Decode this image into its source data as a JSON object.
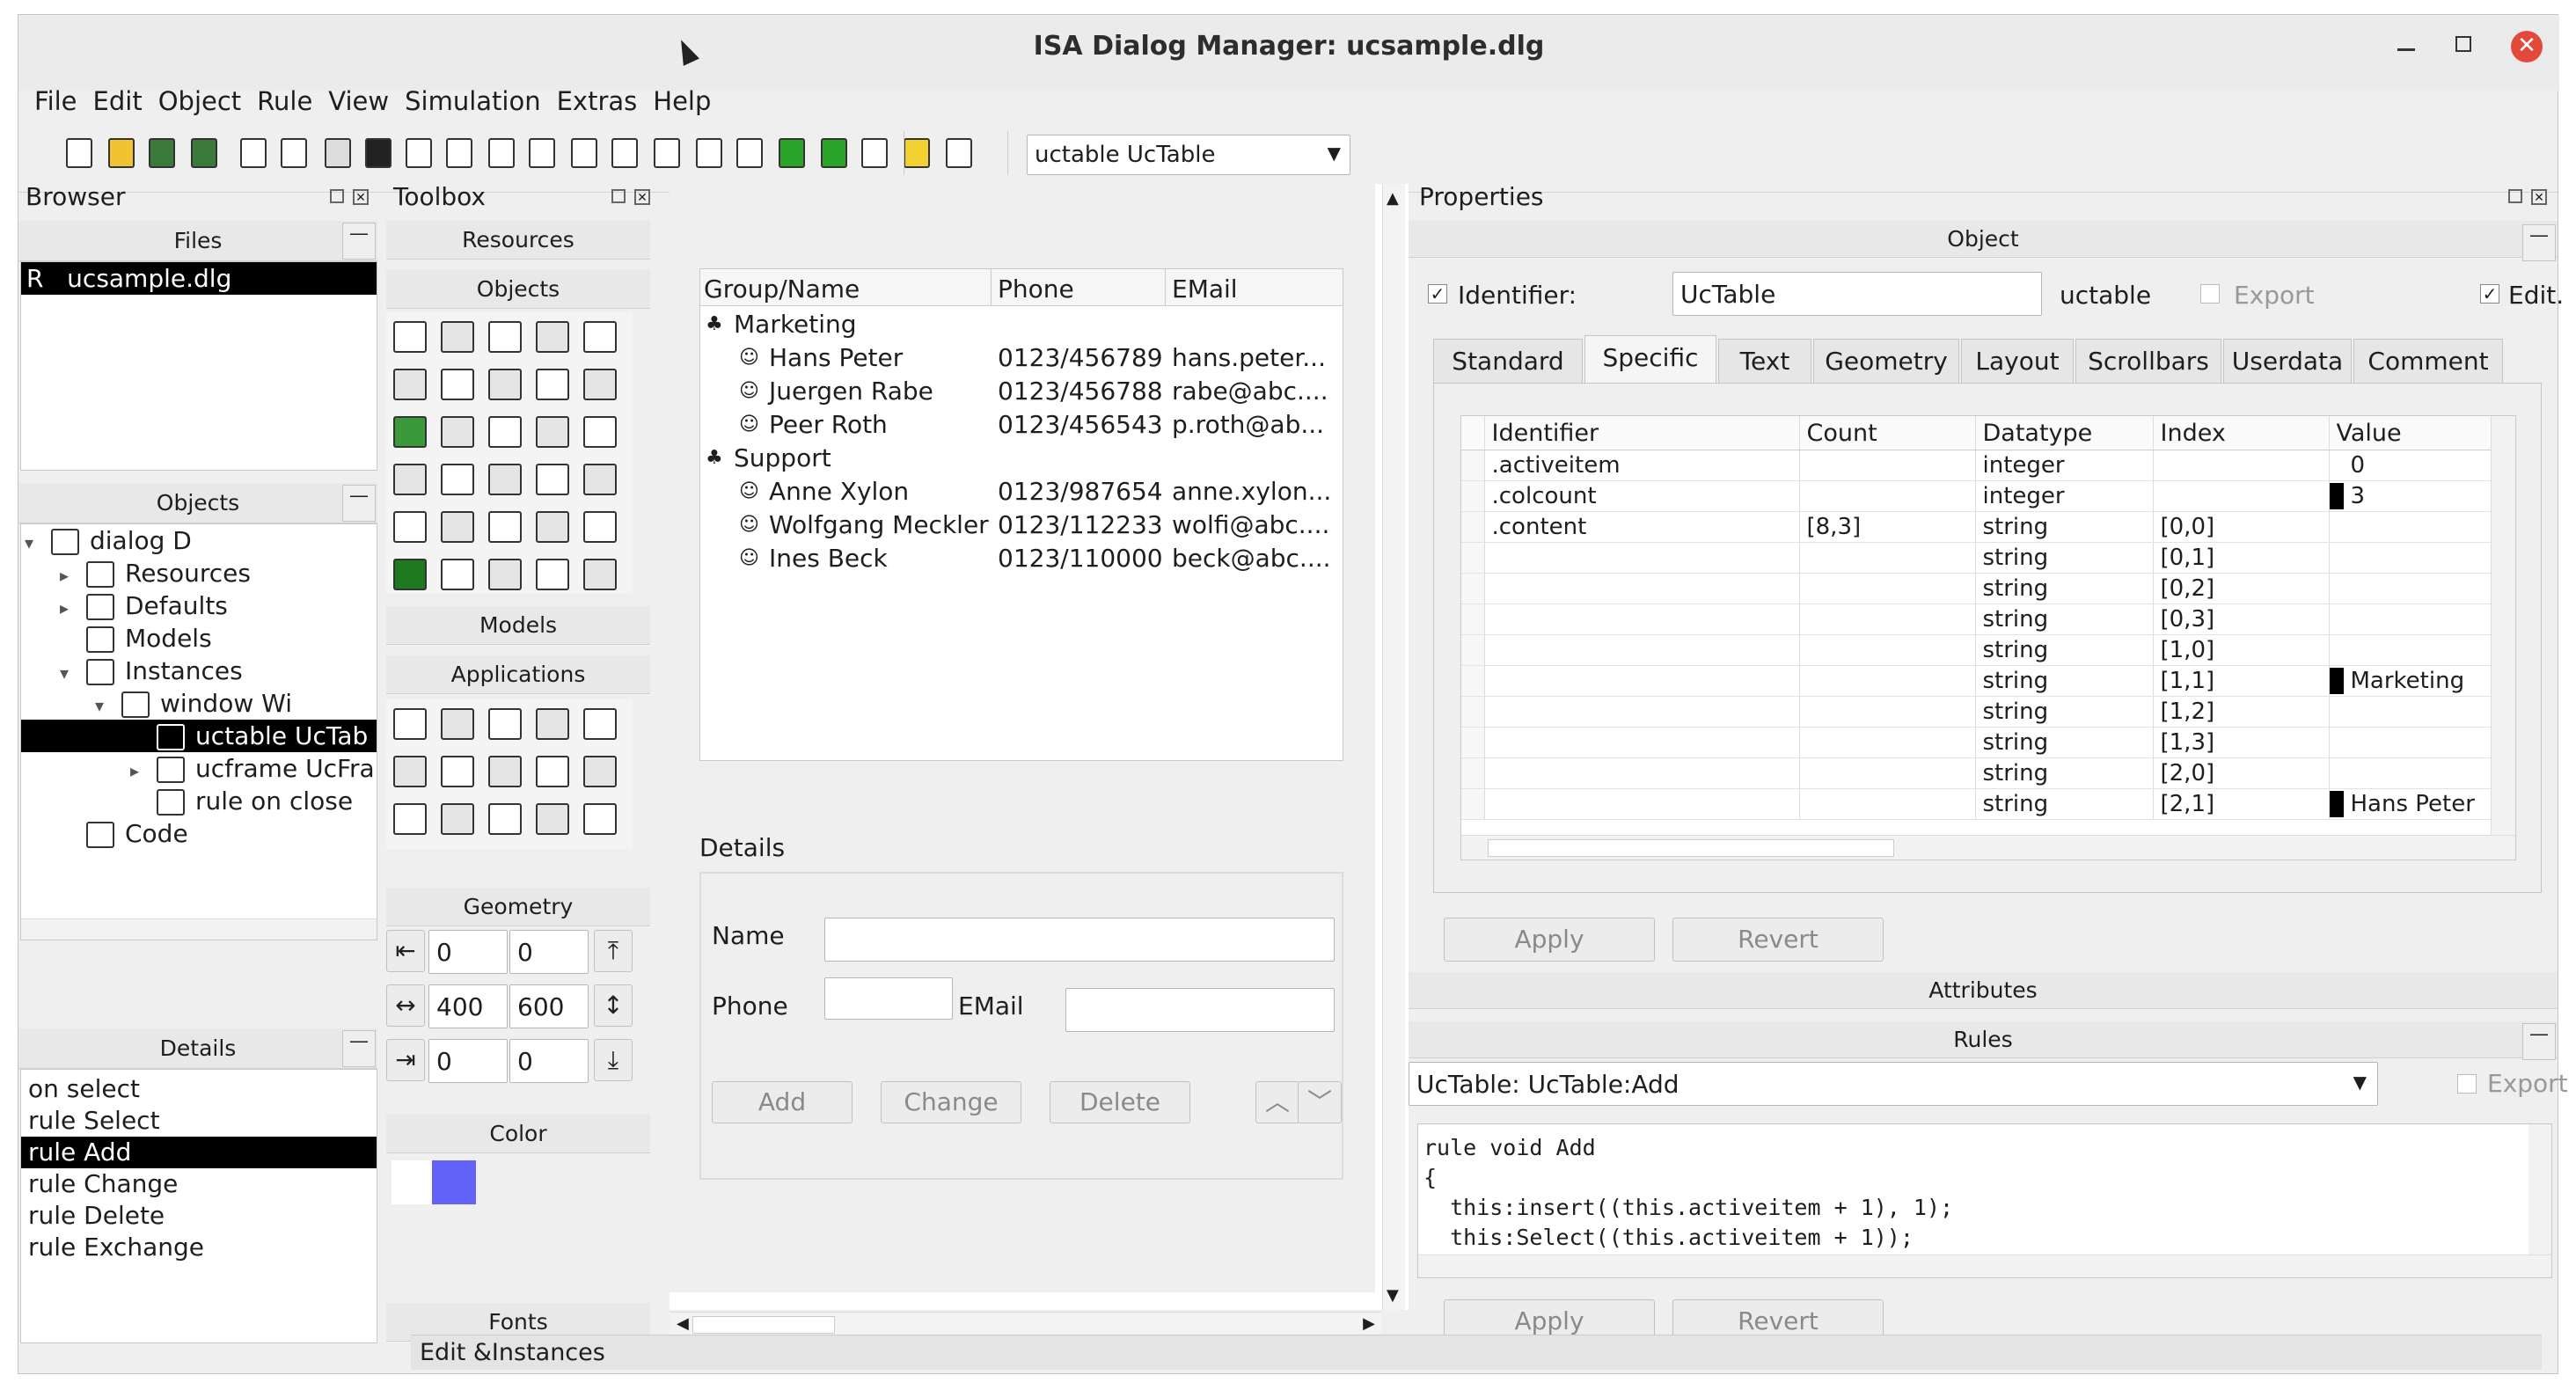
{
  "window": {
    "title": "ISA Dialog Manager: ucsample.dlg"
  },
  "menu": [
    "File",
    "Edit",
    "Object",
    "Rule",
    "View",
    "Simulation",
    "Extras",
    "Help"
  ],
  "toolbar": {
    "combo_value": "uctable UcTable"
  },
  "browser": {
    "title": "Browser",
    "files_header": "Files",
    "file_flag": "R",
    "file_name": "ucsample.dlg",
    "objects_header": "Objects",
    "tree": [
      {
        "label": "dialog D",
        "indent": 0
      },
      {
        "label": "Resources",
        "indent": 1
      },
      {
        "label": "Defaults",
        "indent": 1
      },
      {
        "label": "Models",
        "indent": 1
      },
      {
        "label": "Instances",
        "indent": 1
      },
      {
        "label": "window Wi",
        "indent": 2
      },
      {
        "label": "uctable UcTab",
        "indent": 3
      },
      {
        "label": "ucframe UcFra",
        "indent": 3
      },
      {
        "label": "rule on close",
        "indent": 3
      },
      {
        "label": "Code",
        "indent": 1
      }
    ],
    "details_header": "Details",
    "details": [
      "on select",
      "rule Select",
      "rule Add",
      "rule Change",
      "rule Delete",
      "rule Exchange"
    ]
  },
  "toolbox": {
    "title": "Toolbox",
    "resources": "Resources",
    "objects": "Objects",
    "models": "Models",
    "applications": "Applications",
    "geometry": "Geometry",
    "geo_values": [
      "0",
      "0",
      "400",
      "600",
      "0",
      "0"
    ],
    "color": "Color",
    "fonts": "Fonts"
  },
  "preview": {
    "columns": [
      "Group/Name",
      "Phone",
      "EMail"
    ],
    "rows": [
      {
        "group": "Marketing"
      },
      {
        "name": "Hans Peter",
        "phone": "0123/456789",
        "email": "hans.peter..."
      },
      {
        "name": "Juergen Rabe",
        "phone": "0123/456788",
        "email": "rabe@abc...."
      },
      {
        "name": "Peer Roth",
        "phone": "0123/456543",
        "email": "p.roth@ab..."
      },
      {
        "group": "Support"
      },
      {
        "name": "Anne Xylon",
        "phone": "0123/987654",
        "email": "anne.xylon..."
      },
      {
        "name": "Wolfgang Meckler",
        "phone": "0123/112233",
        "email": "wolfi@abc...."
      },
      {
        "name": "Ines Beck",
        "phone": "0123/110000",
        "email": "beck@abc...."
      }
    ],
    "details_label": "Details",
    "name_label": "Name",
    "phone_label": "Phone",
    "email_label": "EMail",
    "add": "Add",
    "change": "Change",
    "delete": "Delete"
  },
  "properties": {
    "title": "Properties",
    "object_header": "Object",
    "identifier_label": "Identifier:",
    "identifier_value": "UcTable",
    "class_value": "uctable",
    "export_label": "Export",
    "edit_label": "Edit.",
    "tabs": [
      "Standard",
      "Specific",
      "Text",
      "Geometry",
      "Layout",
      "Scrollbars",
      "Userdata",
      "Comment"
    ],
    "grid_columns": [
      "Identifier",
      "Count",
      "Datatype",
      "Index",
      "Value"
    ],
    "grid_rows": [
      {
        "id": ".activeitem",
        "count": "",
        "type": "integer",
        "index": "",
        "value": "0",
        "mark": false
      },
      {
        "id": ".colcount",
        "count": "",
        "type": "integer",
        "index": "",
        "value": "3",
        "mark": true
      },
      {
        "id": ".content",
        "count": "[8,3]",
        "type": "string",
        "index": "[0,0]",
        "value": "",
        "mark": false
      },
      {
        "id": "",
        "count": "",
        "type": "string",
        "index": "[0,1]",
        "value": "",
        "mark": false
      },
      {
        "id": "",
        "count": "",
        "type": "string",
        "index": "[0,2]",
        "value": "",
        "mark": false
      },
      {
        "id": "",
        "count": "",
        "type": "string",
        "index": "[0,3]",
        "value": "",
        "mark": false
      },
      {
        "id": "",
        "count": "",
        "type": "string",
        "index": "[1,0]",
        "value": "",
        "mark": false
      },
      {
        "id": "",
        "count": "",
        "type": "string",
        "index": "[1,1]",
        "value": "Marketing",
        "mark": true
      },
      {
        "id": "",
        "count": "",
        "type": "string",
        "index": "[1,2]",
        "value": "",
        "mark": false
      },
      {
        "id": "",
        "count": "",
        "type": "string",
        "index": "[1,3]",
        "value": "",
        "mark": false
      },
      {
        "id": "",
        "count": "",
        "type": "string",
        "index": "[2,0]",
        "value": "",
        "mark": false
      },
      {
        "id": "",
        "count": "",
        "type": "string",
        "index": "[2,1]",
        "value": "Hans Peter",
        "mark": true
      }
    ],
    "apply": "Apply",
    "revert": "Revert",
    "attributes_header": "Attributes",
    "rules_header": "Rules",
    "rule_combo": "UcTable: UcTable:Add",
    "rule_export": "Export",
    "code": [
      "rule void Add",
      "{",
      "  this:insert((this.activeitem + 1), 1);",
      "  this:Select((this.activeitem + 1));"
    ]
  },
  "status": {
    "text": "Edit &Instances"
  }
}
